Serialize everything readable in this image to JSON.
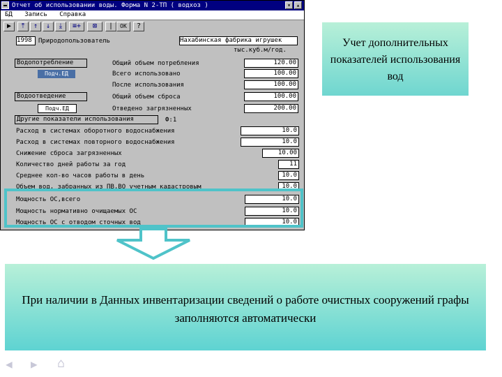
{
  "window": {
    "title": "Отчет об использовании воды. Форма N 2-ТП ( водхоз )",
    "menu": [
      "БД",
      "Запись",
      "Справка"
    ],
    "toolbar_ok": "OK",
    "toolbar_help": "?"
  },
  "form": {
    "year": "1998",
    "user_label": "Природопользователь",
    "user_name": "Нахабинская фабрика игрушек",
    "units": "тыс.куб.м/год.",
    "water_use_button": "Водопотребление",
    "water_use_sub": "Подч.ЕД",
    "total_consumption_label": "Общий объем потребления",
    "total_consumption_value": "120.00",
    "used_label": "Всего использовано",
    "used_value": "100.00",
    "after_use_label": "После использования",
    "after_use_value": "100.00",
    "discharge_button": "Водоотведение",
    "discharge_sub": "Подч.ЕД",
    "total_discharge_label": "Общий объем сброса",
    "total_discharge_value": "100.00",
    "polluted_label": "Отведено загрязненных",
    "polluted_value": "200.00",
    "other_button": "Другие показатели использования",
    "other_suffix": "Ф:1",
    "rows": [
      {
        "label": "Расход в системах оборотного водоснабжения",
        "value": "10.0"
      },
      {
        "label": "Расход в системах повторного водоснабжения",
        "value": "10.0"
      },
      {
        "label": "Снижение сброса загрязненных",
        "value": "10.00"
      },
      {
        "label": "Количество дней работы за год",
        "value": "11"
      },
      {
        "label": "Среднее кол-во часов работы в день",
        "value": "10.0"
      },
      {
        "label": "Объем вод, забранных из ПВ,ВО учетным кадастровым",
        "value": "10.0"
      },
      {
        "label": "Мощность ОС,всего",
        "value": "10.0"
      },
      {
        "label": "Мощность нормативно очищаемых ОС",
        "value": "10.0"
      },
      {
        "label": "Мощность ОС с отводом сточных вод",
        "value": "10.0"
      }
    ]
  },
  "callout_top": "Учет дополнительных показателей использования вод",
  "callout_bottom": "При наличии в Данных инвентаризации сведений о работе очистных сооружений графы заполняются автоматически",
  "accent_color": "#4fc3c9"
}
